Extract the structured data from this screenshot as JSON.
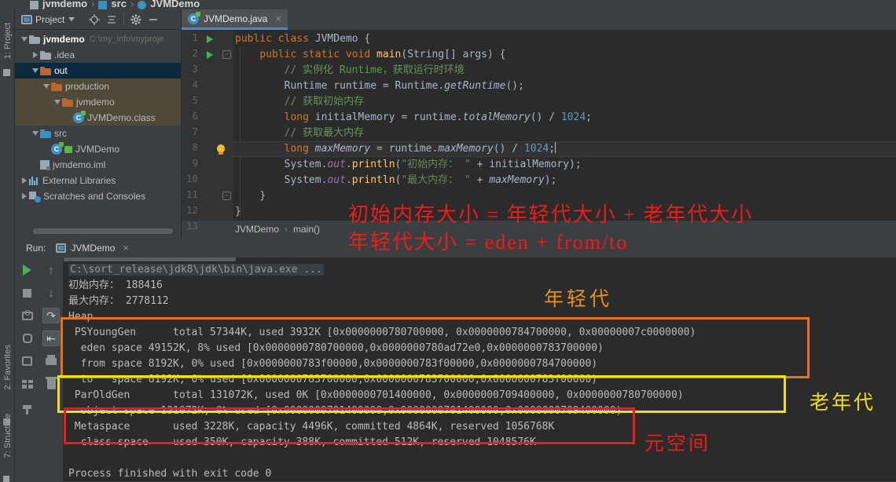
{
  "topbreadcrumb": {
    "items": [
      "jvmdemo",
      "src",
      "JVMDemo"
    ],
    "sep": "›"
  },
  "left_strip": {
    "project_label": "1: Project",
    "favorites_label": "2: Favorites",
    "structure_label": "7: Structure"
  },
  "project_toolbar": {
    "title": "Project",
    "icons": [
      "locate-icon",
      "collapse-all-icon",
      "gear-icon",
      "minimize-icon"
    ]
  },
  "tree": [
    {
      "indent": 0,
      "twisty": "down",
      "icon": "module-folder-icon",
      "label": "jvmdemo",
      "sub": "C:\\my_info\\myproje",
      "bold": true,
      "state": ""
    },
    {
      "indent": 1,
      "twisty": "right",
      "icon": "folder-gray-icon",
      "label": ".idea",
      "sub": "",
      "bold": false,
      "state": ""
    },
    {
      "indent": 1,
      "twisty": "down",
      "icon": "folder-orange-icon",
      "label": "out",
      "sub": "",
      "bold": false,
      "state": "selected"
    },
    {
      "indent": 2,
      "twisty": "down",
      "icon": "folder-orange-icon",
      "label": "production",
      "sub": "",
      "bold": false,
      "state": "amber"
    },
    {
      "indent": 3,
      "twisty": "down",
      "icon": "folder-orange-icon",
      "label": "jvmdemo",
      "sub": "",
      "bold": false,
      "state": "amber"
    },
    {
      "indent": 4,
      "twisty": "none",
      "icon": "class-file-icon",
      "label": "JVMDemo.class",
      "sub": "",
      "bold": false,
      "state": "amber"
    },
    {
      "indent": 1,
      "twisty": "down",
      "icon": "folder-blue-icon",
      "label": "src",
      "sub": "",
      "bold": false,
      "state": ""
    },
    {
      "indent": 2,
      "twisty": "none",
      "icon": "java-class-icon",
      "label": "JVMDemo",
      "sub": "",
      "bold": false,
      "state": ""
    },
    {
      "indent": 1,
      "twisty": "none",
      "icon": "iml-file-icon",
      "label": "jvmdemo.iml",
      "sub": "",
      "bold": false,
      "state": ""
    },
    {
      "indent": 0,
      "twisty": "right",
      "icon": "libraries-icon",
      "label": "External Libraries",
      "sub": "",
      "bold": false,
      "state": ""
    },
    {
      "indent": 0,
      "twisty": "right",
      "icon": "scratches-icon",
      "label": "Scratches and Consoles",
      "sub": "",
      "bold": false,
      "state": ""
    }
  ],
  "editor": {
    "tab_label": "JVMDemo.java",
    "tab_icon": "java-class-icon",
    "tab_close": "×",
    "breadcrumb": [
      "JVMDemo",
      "main()"
    ],
    "breadcrumb_sep": "›",
    "line_numbers": [
      "1",
      "2",
      "3",
      "4",
      "5",
      "6",
      "7",
      "8",
      "9",
      "10",
      "11",
      "12",
      "13"
    ],
    "lines": [
      "public class JVMDemo {",
      "    public static void main(String[] args) {",
      "        // 实例化 Runtime，获取运行时环境",
      "        Runtime runtime = Runtime.getRuntime();",
      "        // 获取初始内存",
      "        long initialMemory = runtime.totalMemory() / 1024;",
      "        // 获取最大内存",
      "        long maxMemory = runtime.maxMemory() / 1024;",
      "        System.out.println(\"初始内存： \" + initialMemory);",
      "        System.out.println(\"最大内存： \" + maxMemory);",
      "    }",
      "}",
      ""
    ],
    "caret_line": 8
  },
  "run_window": {
    "run_label": "Run:",
    "tab_name": "JVMDemo",
    "tab_close": "×",
    "left_icons": [
      "rerun-icon",
      "stop-icon",
      "camera-icon",
      "debug-icon",
      "arrow-in-icon",
      "layout-icon",
      "pin-icon"
    ],
    "right_icons": [
      "scroll-up-icon",
      "scroll-down-icon",
      "soft-wrap-icon",
      "scroll-to-end-icon",
      "print-icon",
      "clear-all-icon"
    ]
  },
  "console": {
    "lines": [
      {
        "text": "C:\\sort_release\\jdk8\\jdk\\bin\\java.exe ...",
        "style": "cmdpath"
      },
      {
        "text": "初始内存： 188416",
        "style": "sysout"
      },
      {
        "text": "最大内存： 2778112",
        "style": "sysout"
      },
      {
        "text": "Heap",
        "style": "sysout"
      },
      {
        "text": " PSYoungGen      total 57344K, used 3932K [0x0000000780700000, 0x0000000784700000, 0x00000007c0000000)",
        "style": "sysout"
      },
      {
        "text": "  eden space 49152K, 8% used [0x0000000780700000,0x0000000780ad72e0,0x0000000783700000)",
        "style": "sysout"
      },
      {
        "text": "  from space 8192K, 0% used [0x0000000783f00000,0x0000000783f00000,0x0000000784700000)",
        "style": "sysout"
      },
      {
        "text": "  to   space 8192K, 0% used [0x0000000783700000,0x0000000783700000,0x0000000783f00000)",
        "style": "sysout"
      },
      {
        "text": " ParOldGen       total 131072K, used 0K [0x0000000701400000, 0x0000000709400000, 0x0000000780700000)",
        "style": "sysout"
      },
      {
        "text": "  object space 131072K, 0% used [0x0000000701400000,0x0000000701400000,0x0000000709400000)",
        "style": "sysout"
      },
      {
        "text": " Metaspace       used 3228K, capacity 4496K, committed 4864K, reserved 1056768K",
        "style": "sysout"
      },
      {
        "text": "  class space    used 350K, capacity 388K, committed 512K, reserved 1048576K",
        "style": "sysout"
      },
      {
        "text": "",
        "style": "sysout"
      },
      {
        "text": "Process finished with exit code 0",
        "style": "sysout"
      }
    ]
  },
  "annotations": {
    "formula_line1": "初始内存大小 = 年轻代大小 + 老年代大小",
    "formula_line2": "年轻代大小 = eden + from/to",
    "young_gen": "年轻代",
    "old_gen": "老年代",
    "metaspace": "元空间",
    "colors": {
      "young_box": "#e8711a",
      "old_box": "#f3e00c",
      "meta_box": "#ef1b1b",
      "formula": "#ef1b1b"
    }
  }
}
